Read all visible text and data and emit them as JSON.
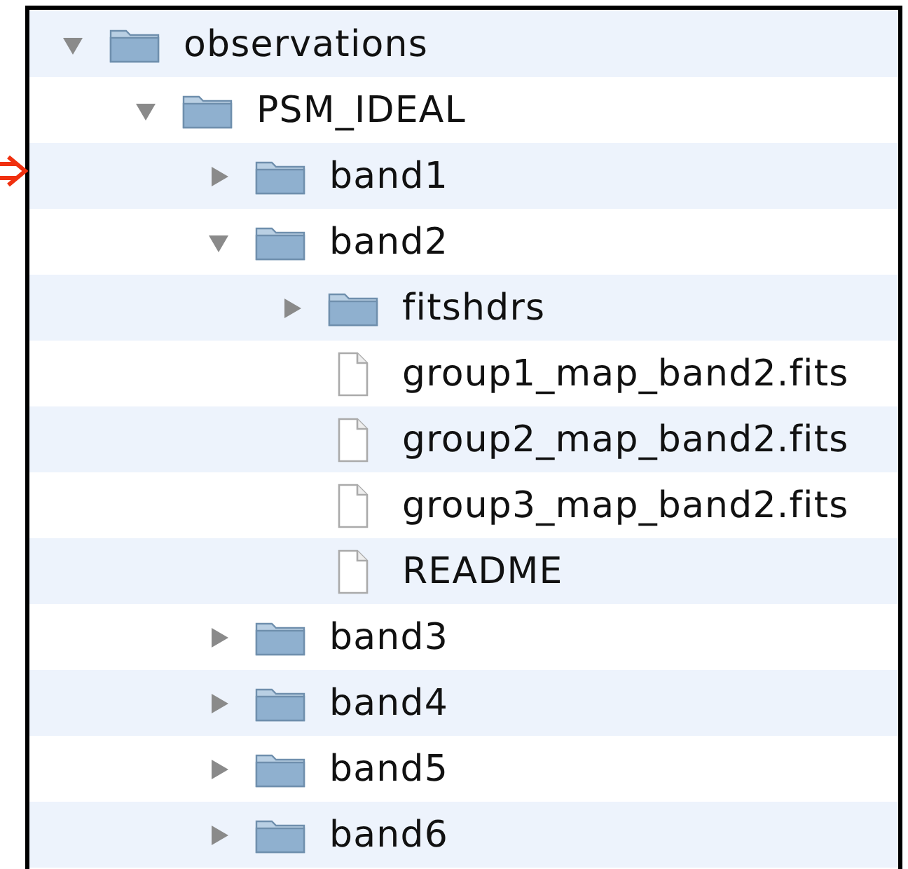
{
  "tree": [
    {
      "kind": "folder",
      "name": "observations",
      "expanded": true,
      "children": [
        {
          "kind": "folder",
          "name": "PSM_IDEAL",
          "expanded": true,
          "children": [
            {
              "kind": "folder",
              "name": "band1",
              "expanded": false
            },
            {
              "kind": "folder",
              "name": "band2",
              "expanded": true,
              "children": [
                {
                  "kind": "folder",
                  "name": "fitshdrs",
                  "expanded": false
                },
                {
                  "kind": "file",
                  "name": "group1_map_band2.fits"
                },
                {
                  "kind": "file",
                  "name": "group2_map_band2.fits"
                },
                {
                  "kind": "file",
                  "name": "group3_map_band2.fits"
                },
                {
                  "kind": "file",
                  "name": "README"
                }
              ]
            },
            {
              "kind": "folder",
              "name": "band3",
              "expanded": false
            },
            {
              "kind": "folder",
              "name": "band4",
              "expanded": false
            },
            {
              "kind": "folder",
              "name": "band5",
              "expanded": false
            },
            {
              "kind": "folder",
              "name": "band6",
              "expanded": false
            }
          ]
        }
      ]
    }
  ]
}
